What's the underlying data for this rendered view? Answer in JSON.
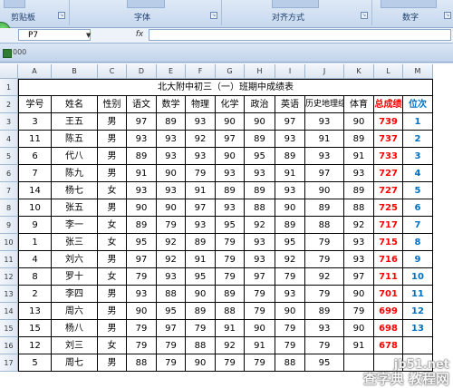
{
  "ribbon": {
    "groups": [
      {
        "label": "剪贴板"
      },
      {
        "label": "字体"
      },
      {
        "label": "对齐方式"
      },
      {
        "label": "数字"
      }
    ]
  },
  "formula_bar": {
    "name_box": "P7",
    "fx_label": "fx",
    "formula": ""
  },
  "workbook": {
    "title": "000"
  },
  "columns": [
    "A",
    "B",
    "C",
    "D",
    "E",
    "F",
    "G",
    "H",
    "I",
    "J",
    "K",
    "L",
    "M"
  ],
  "row_numbers": [
    "1",
    "2",
    "3",
    "4",
    "5",
    "6",
    "7",
    "8",
    "9",
    "10",
    "11",
    "12",
    "13",
    "14",
    "15",
    "16",
    "17"
  ],
  "sheet": {
    "title": "北大附中初三（一）班期中成绩表",
    "headers": [
      "学号",
      "姓名",
      "性别",
      "语文",
      "数学",
      "物理",
      "化学",
      "政治",
      "英语",
      "历史地理综合",
      "体育",
      "总成绩",
      "位次"
    ],
    "rows": [
      [
        "3",
        "王五",
        "男",
        "97",
        "89",
        "93",
        "90",
        "90",
        "97",
        "93",
        "90",
        "739",
        "1"
      ],
      [
        "11",
        "陈五",
        "男",
        "93",
        "93",
        "92",
        "97",
        "89",
        "93",
        "91",
        "89",
        "737",
        "2"
      ],
      [
        "6",
        "代八",
        "男",
        "89",
        "93",
        "93",
        "90",
        "95",
        "89",
        "93",
        "91",
        "733",
        "3"
      ],
      [
        "7",
        "陈九",
        "男",
        "91",
        "90",
        "79",
        "93",
        "93",
        "91",
        "97",
        "93",
        "727",
        "4"
      ],
      [
        "14",
        "杨七",
        "女",
        "93",
        "93",
        "91",
        "89",
        "89",
        "93",
        "90",
        "89",
        "727",
        "5"
      ],
      [
        "10",
        "张五",
        "男",
        "90",
        "90",
        "97",
        "93",
        "88",
        "90",
        "89",
        "88",
        "725",
        "6"
      ],
      [
        "9",
        "李一",
        "女",
        "89",
        "79",
        "93",
        "95",
        "92",
        "89",
        "88",
        "92",
        "717",
        "7"
      ],
      [
        "1",
        "张三",
        "女",
        "95",
        "92",
        "89",
        "79",
        "93",
        "95",
        "79",
        "93",
        "715",
        "8"
      ],
      [
        "4",
        "刘六",
        "男",
        "97",
        "92",
        "91",
        "79",
        "93",
        "92",
        "79",
        "93",
        "716",
        "9"
      ],
      [
        "8",
        "罗十",
        "女",
        "79",
        "93",
        "95",
        "79",
        "97",
        "79",
        "92",
        "97",
        "711",
        "10"
      ],
      [
        "2",
        "李四",
        "男",
        "93",
        "88",
        "90",
        "89",
        "79",
        "93",
        "79",
        "90",
        "701",
        "11"
      ],
      [
        "13",
        "周六",
        "男",
        "90",
        "95",
        "89",
        "88",
        "79",
        "90",
        "89",
        "79",
        "699",
        "12"
      ],
      [
        "15",
        "杨八",
        "男",
        "79",
        "97",
        "79",
        "91",
        "90",
        "79",
        "93",
        "90",
        "698",
        "13"
      ],
      [
        "12",
        "刘三",
        "女",
        "79",
        "79",
        "88",
        "92",
        "91",
        "79",
        "79",
        "91",
        "678",
        ""
      ],
      [
        "5",
        "周七",
        "男",
        "88",
        "79",
        "90",
        "79",
        "79",
        "88",
        "95",
        "",
        "",
        ""
      ]
    ]
  },
  "watermark": {
    "site": "jb51.net",
    "text": "查字典 教程网"
  }
}
